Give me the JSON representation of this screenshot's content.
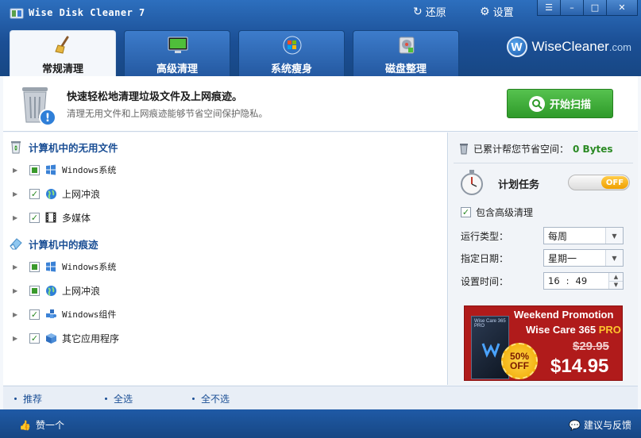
{
  "app": {
    "title": "Wise Disk Cleaner 7"
  },
  "topbar": {
    "restore_label": "还原",
    "settings_label": "设置"
  },
  "window_controls": {
    "menu": "☰",
    "minimize": "–",
    "maximize": "□",
    "close": "✕"
  },
  "tabs": [
    {
      "label": "常规清理",
      "icon": "broom-icon",
      "active": true
    },
    {
      "label": "高级清理",
      "icon": "monitor-icon",
      "active": false
    },
    {
      "label": "系统瘦身",
      "icon": "windows-logo-icon",
      "active": false
    },
    {
      "label": "磁盘整理",
      "icon": "disk-defrag-icon",
      "active": false
    }
  ],
  "brand": {
    "logo_letter": "W",
    "name": "WiseCleaner",
    "suffix": ".com"
  },
  "banner": {
    "title": "快速轻松地清理垃圾文件及上网痕迹。",
    "subtitle": "清理无用文件和上网痕迹能够节省空间保护隐私。",
    "scan_button": "开始扫描"
  },
  "sections": [
    {
      "title": "计算机中的无用文件",
      "icon": "recycle-bin-icon",
      "items": [
        {
          "label": "Windows系统",
          "state": "partial",
          "icon": "windows-logo-icon"
        },
        {
          "label": "上网冲浪",
          "state": "checked",
          "icon": "globe-icon"
        },
        {
          "label": "多媒体",
          "state": "checked",
          "icon": "film-icon"
        }
      ]
    },
    {
      "title": "计算机中的痕迹",
      "icon": "eraser-icon",
      "items": [
        {
          "label": "Windows系统",
          "state": "partial",
          "icon": "windows-logo-icon"
        },
        {
          "label": "上网冲浪",
          "state": "partial",
          "icon": "globe-icon"
        },
        {
          "label": "Windows组件",
          "state": "checked",
          "icon": "puzzle-icon"
        },
        {
          "label": "其它应用程序",
          "state": "checked",
          "icon": "box-icon"
        }
      ]
    }
  ],
  "right": {
    "saved_label": "已累计帮您节省空间：",
    "saved_value": "0 Bytes",
    "schedule_title": "计划任务",
    "toggle_state": "OFF",
    "include_advanced": "包含高级清理",
    "run_type_label": "运行类型：",
    "run_type_value": "每周",
    "date_label": "指定日期：",
    "date_value": "星期一",
    "time_label": "设置时间：",
    "time_hour": "16",
    "time_sep": ":",
    "time_minute": "49"
  },
  "promo": {
    "title": "Weekend Promotion",
    "product": "Wise Care 365",
    "product_suffix": "PRO",
    "old_price": "$29.95",
    "new_price": "$14.95",
    "badge_top": "50%",
    "badge_bottom": "OFF",
    "box_label": "Wise Care 365 PRO"
  },
  "links": {
    "recommend": "推荐",
    "select_all": "全选",
    "select_none": "全不选"
  },
  "footer": {
    "like": "赞一个",
    "feedback": "建议与反馈"
  },
  "colors": {
    "header_blue": "#1f5aa6",
    "scan_green": "#2e9a29",
    "promo_red": "#b01b1b",
    "saved_green": "#2b8a24"
  }
}
